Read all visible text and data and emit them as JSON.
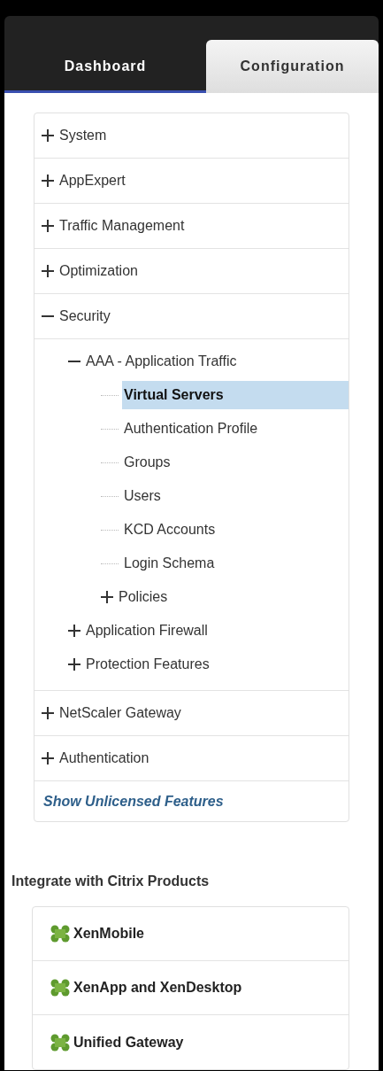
{
  "tabs": [
    {
      "label": "Dashboard",
      "selected": false
    },
    {
      "label": "Configuration",
      "selected": true
    }
  ],
  "nav": [
    {
      "label": "System",
      "expanded": false
    },
    {
      "label": "AppExpert",
      "expanded": false
    },
    {
      "label": "Traffic Management",
      "expanded": false
    },
    {
      "label": "Optimization",
      "expanded": false
    },
    {
      "label": "Security",
      "expanded": true,
      "children": [
        {
          "label": "AAA - Application Traffic",
          "expanded": true,
          "children": [
            {
              "label": "Virtual Servers",
              "selected": true
            },
            {
              "label": "Authentication Profile",
              "selected": false
            },
            {
              "label": "Groups",
              "selected": false
            },
            {
              "label": "Users",
              "selected": false
            },
            {
              "label": "KCD Accounts",
              "selected": false
            },
            {
              "label": "Login Schema",
              "selected": false
            },
            {
              "label": "Policies",
              "expanded": false
            }
          ]
        },
        {
          "label": "Application Firewall",
          "expanded": false
        },
        {
          "label": "Protection Features",
          "expanded": false
        }
      ]
    },
    {
      "label": "NetScaler Gateway",
      "expanded": false
    },
    {
      "label": "Authentication",
      "expanded": false
    }
  ],
  "show_unlicensed": "Show Unlicensed Features",
  "integrate": {
    "title": "Integrate with Citrix Products",
    "products": [
      "XenMobile",
      "XenApp and XenDesktop",
      "Unified Gateway"
    ]
  }
}
